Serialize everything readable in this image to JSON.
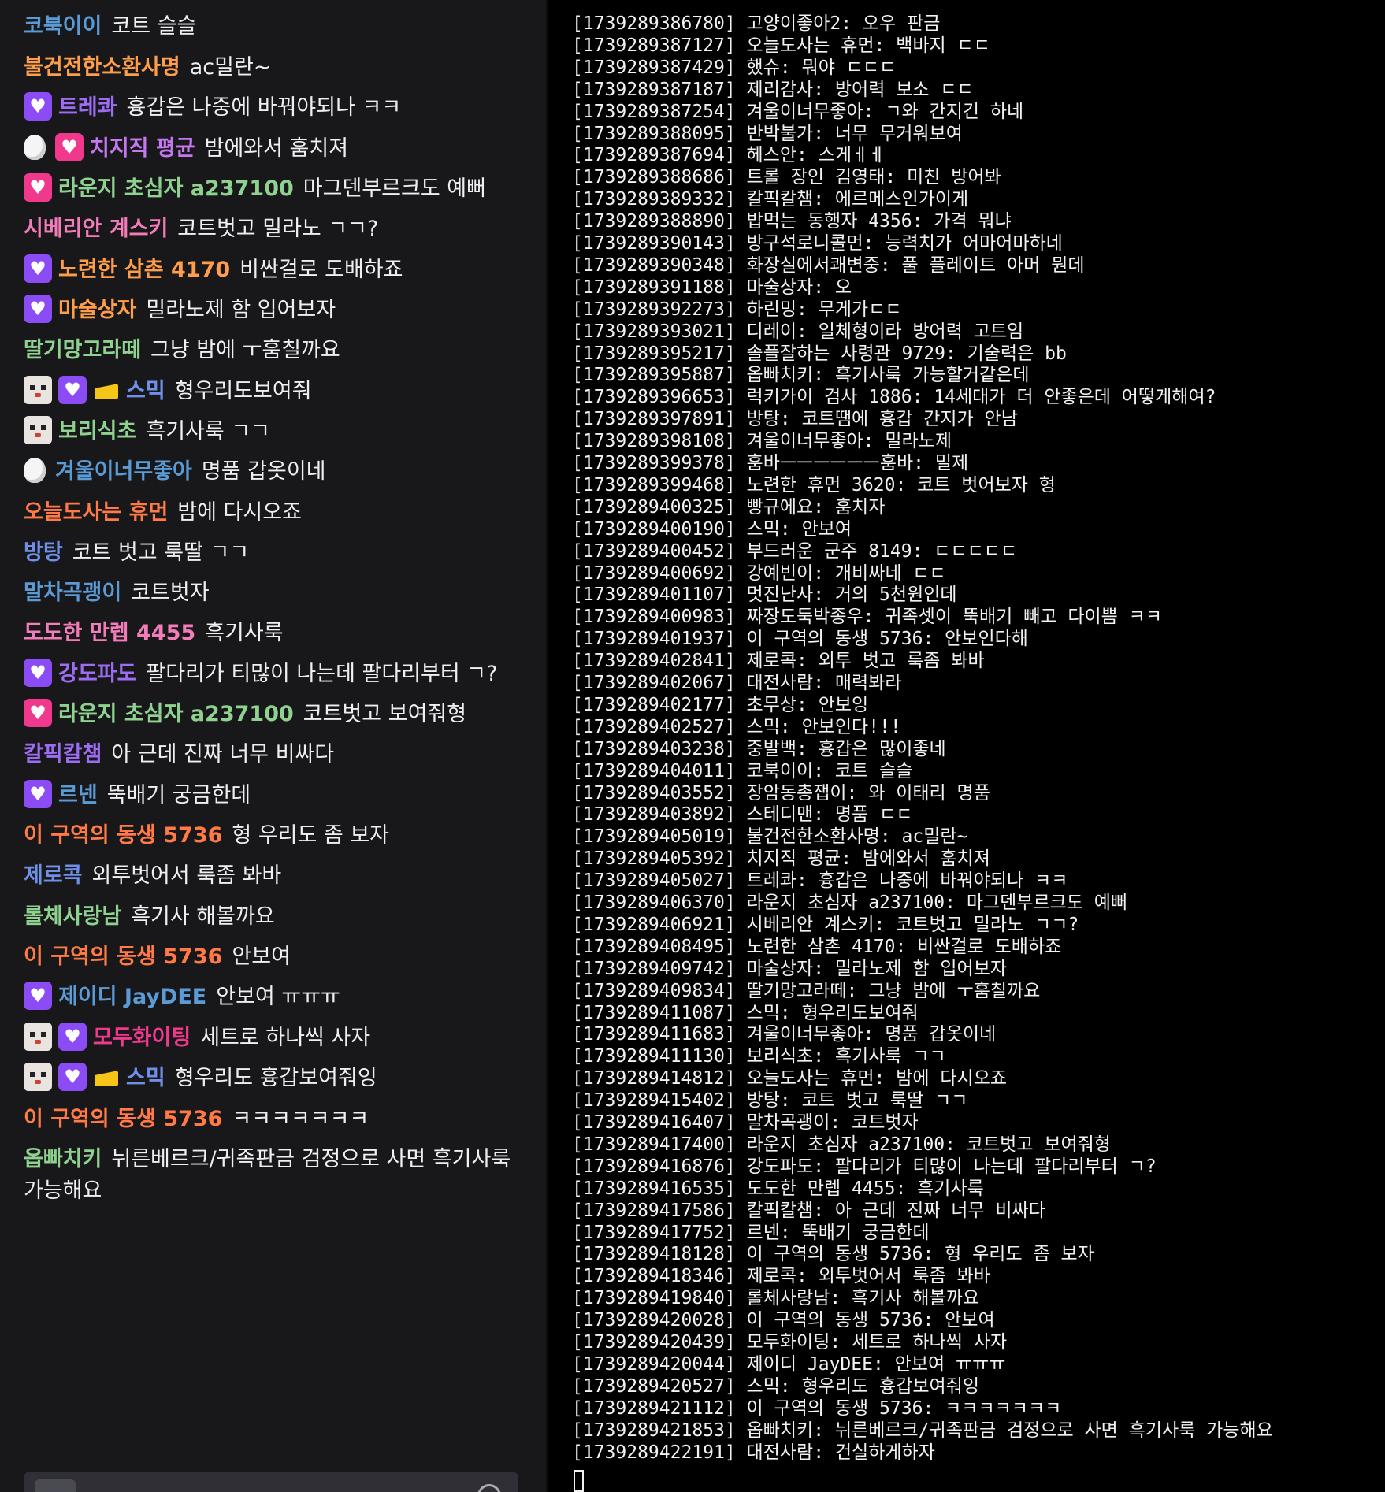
{
  "chat": {
    "messages": [
      {
        "badges": [],
        "user": "코북이이",
        "color": "#5b9bd5",
        "text": "코트 슬슬"
      },
      {
        "badges": [],
        "user": "불건전한소환사명",
        "color": "#ff9e4a",
        "text": "ac밀란~"
      },
      {
        "badges": [
          "sub-purple"
        ],
        "user": "트레콰",
        "color": "#9c6cf2",
        "text": "흉갑은 나중에 바꿔야되나 ㅋㅋ"
      },
      {
        "badges": [
          "egg",
          "sub-pink"
        ],
        "user": "치지직 평균",
        "color": "#c678f0",
        "text": "밤에와서 훔치져"
      },
      {
        "badges": [
          "sub-pink"
        ],
        "user": "라운지 초심자 a237100",
        "color": "#8fd18f",
        "text": "마그덴부르크도 예뻐"
      },
      {
        "badges": [],
        "user": "시베리안 계스키",
        "color": "#f27db8",
        "text": "코트벗고 밀라노 ㄱㄱ?"
      },
      {
        "badges": [
          "sub-purple"
        ],
        "user": "노련한 삼촌 4170",
        "color": "#ff9e4a",
        "text": "비싼걸로 도배하죠"
      },
      {
        "badges": [
          "sub-purple"
        ],
        "user": "마술상자",
        "color": "#ff9e4a",
        "text": "밀라노제 함 입어보자"
      },
      {
        "badges": [],
        "user": "딸기망고라떼",
        "color": "#8fd18f",
        "text": "그냥 밤에 ㅜ훔칠까요"
      },
      {
        "badges": [
          "dog",
          "sub-purple",
          "cheese"
        ],
        "user": "스믹",
        "color": "#6f8fe8",
        "text": "형우리도보여줘"
      },
      {
        "badges": [
          "dog"
        ],
        "user": "보리식초",
        "color": "#8fd18f",
        "text": "흑기사룩 ㄱㄱ"
      },
      {
        "badges": [
          "egg"
        ],
        "user": "겨울이너무좋아",
        "color": "#5b9bd5",
        "text": "명품 갑옷이네"
      },
      {
        "badges": [],
        "user": "오늘도사는 휴먼",
        "color": "#ff7a45",
        "text": "밤에 다시오죠"
      },
      {
        "badges": [],
        "user": "방탕",
        "color": "#6f8fe8",
        "text": "코트 벗고 룩딸 ㄱㄱ"
      },
      {
        "badges": [],
        "user": "말차곡괭이",
        "color": "#5b9bd5",
        "text": "코트벗자"
      },
      {
        "badges": [],
        "user": "도도한 만렙 4455",
        "color": "#f27db8",
        "text": "흑기사룩"
      },
      {
        "badges": [
          "sub-purple"
        ],
        "user": "강도파도",
        "color": "#9c6cf2",
        "text": "팔다리가 티많이 나는데 팔다리부터 ㄱ?"
      },
      {
        "badges": [
          "sub-pink"
        ],
        "user": "라운지 초심자 a237100",
        "color": "#8fd18f",
        "text": "코트벗고 보여줘형"
      },
      {
        "badges": [],
        "user": "칼픽칼챔",
        "color": "#9c6cf2",
        "text": "아 근데 진짜 너무 비싸다"
      },
      {
        "badges": [
          "sub-purple"
        ],
        "user": "르넨",
        "color": "#5b9bd5",
        "text": "뚝배기 궁금한데"
      },
      {
        "badges": [],
        "user": "이 구역의 동생 5736",
        "color": "#ff7a45",
        "text": "형 우리도 좀 보자"
      },
      {
        "badges": [],
        "user": "제로콕",
        "color": "#6f8fe8",
        "text": "외투벗어서 룩좀 봐바"
      },
      {
        "badges": [],
        "user": "롤체사랑남",
        "color": "#8fd18f",
        "text": "흑기사 해볼까요"
      },
      {
        "badges": [],
        "user": "이 구역의 동생 5736",
        "color": "#ff7a45",
        "text": "안보여"
      },
      {
        "badges": [
          "sub-purple"
        ],
        "user": "제이디 JayDEE",
        "color": "#5b9bd5",
        "text": "안보여 ㅠㅠㅠ"
      },
      {
        "badges": [
          "dog",
          "sub-purple"
        ],
        "user": "모두화이팅",
        "color": "#f0388c",
        "text": "세트로 하나씩 사자"
      },
      {
        "badges": [
          "dog",
          "sub-purple",
          "cheese"
        ],
        "user": "스믹",
        "color": "#6f8fe8",
        "text": "형우리도 흉갑보여줘잉"
      },
      {
        "badges": [],
        "user": "이 구역의 동생 5736",
        "color": "#ff7a45",
        "text": "ㅋㅋㅋㅋㅋㅋㅋ"
      },
      {
        "badges": [],
        "user": "옵빠치키",
        "color": "#8fd18f",
        "text": "뉘른베르크/귀족판금 검정으로 사면 흑기사룩 가능해요"
      }
    ]
  },
  "terminal": {
    "lines": [
      "[1739289386780] 고양이좋아2: 오우 판금",
      "[1739289387127] 오늘도사는 휴먼: 백바지 ㄷㄷ",
      "[1739289387429] 했슈: 뭐야 ㄷㄷㄷ",
      "[1739289387187] 제리감사: 방어력 보소 ㄷㄷ",
      "[1739289387254] 겨울이너무좋아: ㄱ와 간지긴 하네",
      "[1739289388095] 반박불가: 너무 무거워보여",
      "[1739289387694] 헤스안: 스게ㅔㅔ",
      "[1739289388686] 트롤 장인 김영태: 미친 방어봐",
      "[1739289389332] 칼픽칼챔: 에르메스인가이게",
      "[1739289388890] 밥먹는 동행자 4356: 가격 뭐냐",
      "[1739289390143] 방구석로니콜먼: 능력치가 어마어마하네",
      "[1739289390348] 화장실에서쾌변중: 풀 플레이트 아머 뭔데",
      "[1739289391188] 마술상자: 오",
      "[1739289392273] 하린밍: 무게가ㄷㄷ",
      "[1739289393021] 디레이: 일체형이라 방어력 고트임",
      "[1739289395217] 솔플잘하는 사령관 9729: 기술력은 bb",
      "[1739289395887] 옵빠치키: 흑기사룩 가능할거같은데",
      "[1739289396653] 럭키가이 검사 1886: 14세대가 더 안좋은데 어떻게해여?",
      "[1739289397891] 방탕: 코트땜에 흉갑 간지가 안남",
      "[1739289398108] 겨울이너무좋아: 밀라노제",
      "[1739289399378] 훔바ㅡㅡㅡㅡㅡㅡ훔바: 밀제",
      "[1739289399468] 노련한 휴먼 3620: 코트 벗어보자 형",
      "[1739289400325] 빵규에요: 훔치자",
      "[1739289400190] 스믹: 안보여",
      "[1739289400452] 부드러운 군주 8149: ㄷㄷㄷㄷㄷ",
      "[1739289400692] 강예빈이: 개비싸네 ㄷㄷ",
      "[1739289401107] 멋진난사: 거의 5천원인데",
      "[1739289400983] 짜장도둑박종우: 귀족셋이 뚝배기 빼고 다이쁨 ㅋㅋ",
      "[1739289401937] 이 구역의 동생 5736: 안보인다해",
      "[1739289402841] 제로콕: 외투 벗고 룩좀 봐바",
      "[1739289402067] 대전사람: 매력봐라",
      "[1739289402177] 초무상: 안보잉",
      "[1739289402527] 스믹: 안보인다!!!",
      "[1739289403238] 중발백: 흉갑은 많이좋네",
      "[1739289404011] 코북이이: 코트 슬슬",
      "[1739289403552] 장암동총잽이: 와 이태리 명품",
      "[1739289403892] 스테디맨: 명품 ㄷㄷ",
      "[1739289405019] 불건전한소환사명: ac밀란~",
      "[1739289405392] 치지직 평균: 밤에와서 훔치져",
      "[1739289405027] 트레콰: 흉갑은 나중에 바꿔야되나 ㅋㅋ",
      "[1739289406370] 라운지 초심자 a237100: 마그덴부르크도 예뻐",
      "[1739289406921] 시베리안 계스키: 코트벗고 밀라노 ㄱㄱ?",
      "[1739289408495] 노련한 삼촌 4170: 비싼걸로 도배하죠",
      "[1739289409742] 마술상자: 밀라노제 함 입어보자",
      "[1739289409834] 딸기망고라떼: 그냥 밤에 ㅜ훔칠까요",
      "[1739289411087] 스믹: 형우리도보여줘",
      "[1739289411683] 겨울이너무좋아: 명품 갑옷이네",
      "[1739289411130] 보리식초: 흑기사룩 ㄱㄱ",
      "[1739289414812] 오늘도사는 휴먼: 밤에 다시오죠",
      "[1739289415402] 방탕: 코트 벗고 룩딸 ㄱㄱ",
      "[1739289416407] 말차곡괭이: 코트벗자",
      "[1739289417400] 라운지 초심자 a237100: 코트벗고 보여줘형",
      "[1739289416876] 강도파도: 팔다리가 티많이 나는데 팔다리부터 ㄱ?",
      "[1739289416535] 도도한 만렙 4455: 흑기사룩",
      "[1739289417586] 칼픽칼챔: 아 근데 진짜 너무 비싸다",
      "[1739289417752] 르넨: 뚝배기 궁금한데",
      "[1739289418128] 이 구역의 동생 5736: 형 우리도 좀 보자",
      "[1739289418346] 제로콕: 외투벗어서 룩좀 봐바",
      "[1739289419840] 롤체사랑남: 흑기사 해볼까요",
      "[1739289420028] 이 구역의 동생 5736: 안보여",
      "[1739289420439] 모두화이팅: 세트로 하나씩 사자",
      "[1739289420044] 제이디 JayDEE: 안보여 ㅠㅠㅠ",
      "[1739289420527] 스믹: 형우리도 흉갑보여줘잉",
      "[1739289421112] 이 구역의 동생 5736: ㅋㅋㅋㅋㅋㅋㅋ",
      "[1739289421853] 옵빠치키: 뉘른베르크/귀족판금 검정으로 사면 흑기사룩 가능해요",
      "[1739289422191] 대전사람: 건실하게하자"
    ]
  }
}
